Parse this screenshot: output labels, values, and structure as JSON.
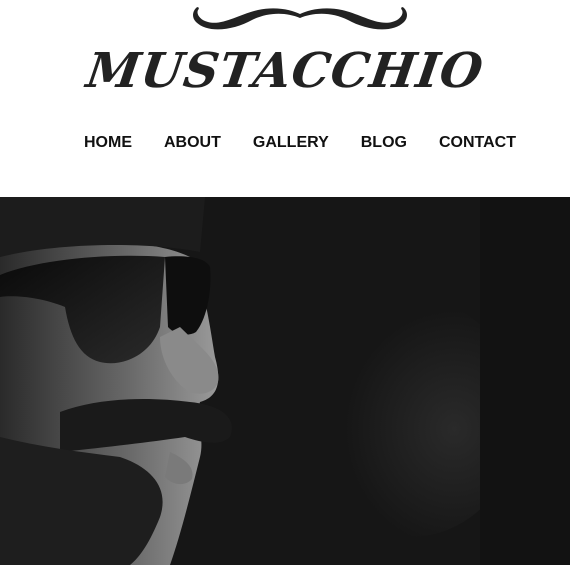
{
  "site": {
    "logo_text": "MUSTACCHIO",
    "logo_icon": "mustache-icon"
  },
  "nav": {
    "items": [
      {
        "label": "HOME"
      },
      {
        "label": "ABOUT"
      },
      {
        "label": "GALLERY"
      },
      {
        "label": "BLOG"
      },
      {
        "label": "CONTACT"
      }
    ]
  },
  "hero": {
    "image": "black-and-white photo of a man with sunglasses, beanie and mustache in profile",
    "background_color": "#161616"
  },
  "colors": {
    "text_dark": "#111111",
    "header_bg": "#ffffff"
  }
}
